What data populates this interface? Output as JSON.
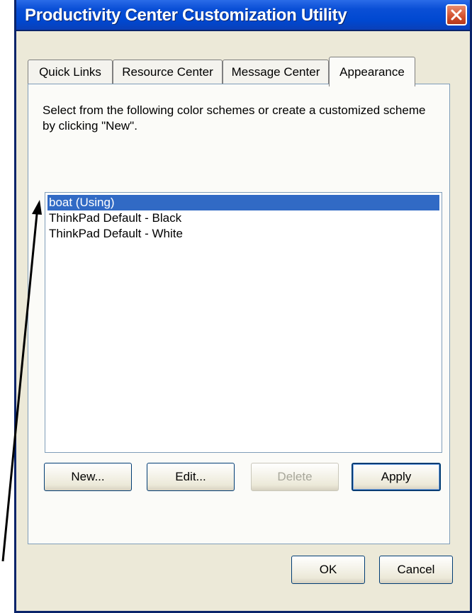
{
  "window": {
    "title": "Productivity Center Customization Utility"
  },
  "tabs": [
    {
      "label": "Quick Links",
      "active": false
    },
    {
      "label": "Resource Center",
      "active": false
    },
    {
      "label": "Message Center",
      "active": false
    },
    {
      "label": "Appearance",
      "active": true
    }
  ],
  "appearance": {
    "description": "Select from the following color schemes or create a customized scheme by clicking \"New\".",
    "schemes": [
      {
        "label": "boat  (Using)",
        "selected": true
      },
      {
        "label": "ThinkPad Default - Black",
        "selected": false
      },
      {
        "label": "ThinkPad Default - White",
        "selected": false
      }
    ],
    "buttons": {
      "new": "New...",
      "edit": "Edit...",
      "delete": "Delete",
      "apply": "Apply"
    }
  },
  "footer": {
    "ok": "OK",
    "cancel": "Cancel"
  },
  "colors": {
    "titlebar": "#0a4fd6",
    "selection": "#316ac5",
    "close_button": "#d2502d",
    "dialog_face": "#ece9d8"
  },
  "icons": {
    "close": "close-icon",
    "annotation": "arrow-annotation"
  }
}
